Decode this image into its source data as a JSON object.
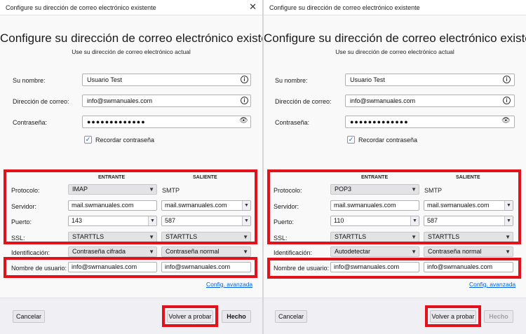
{
  "window_title": "Configure su dirección de correo electrónico existente",
  "heading": "Configure su dirección de correo electrónico existente",
  "subheading": "Use su dirección de correo electrónico actual",
  "labels": {
    "name": "Su nombre:",
    "email": "Dirección de correo:",
    "password": "Contraseña:",
    "remember": "Recordar contraseña",
    "incoming": "ENTRANTE",
    "outgoing": "SALIENTE",
    "protocol": "Protocolo:",
    "server": "Servidor:",
    "port": "Puerto:",
    "ssl": "SSL:",
    "identification": "Identificación:",
    "username": "Nombre de usuario:",
    "advanced": "Config. avanzada"
  },
  "buttons": {
    "cancel": "Cancelar",
    "retest": "Volver a probar",
    "done": "Hecho"
  },
  "colors": {
    "highlight": "#e2121d",
    "link": "#0060df"
  },
  "left": {
    "name_value": "Usuario Test",
    "email_value": "info@swmanuales.com",
    "password_mask": "●●●●●●●●●●●●●",
    "remember_checked": true,
    "incoming": {
      "protocol": "IMAP",
      "server": "mail.swmanuales.com",
      "port": "143",
      "ssl": "STARTTLS",
      "identification": "Contraseña cifrada",
      "username": "info@swmanuales.com"
    },
    "outgoing": {
      "protocol": "SMTP",
      "server": "mail.swmanuales.com",
      "port": "587",
      "ssl": "STARTTLS",
      "identification": "Contraseña normal",
      "username": "info@swmanuales.com"
    },
    "done_enabled": true
  },
  "right": {
    "name_value": "Usuario Test",
    "email_value": "info@swmanuales.com",
    "password_mask": "●●●●●●●●●●●●●",
    "remember_checked": true,
    "incoming": {
      "protocol": "POP3",
      "server": "mail.swmanuales.com",
      "port": "110",
      "ssl": "STARTTLS",
      "identification": "Autodetectar",
      "username": "info@swmanuales.com"
    },
    "outgoing": {
      "protocol": "SMTP",
      "server": "mail.swmanuales.com",
      "port": "587",
      "ssl": "STARTTLS",
      "identification": "Contraseña normal",
      "username": "info@swmanuales.com"
    },
    "done_enabled": false
  }
}
